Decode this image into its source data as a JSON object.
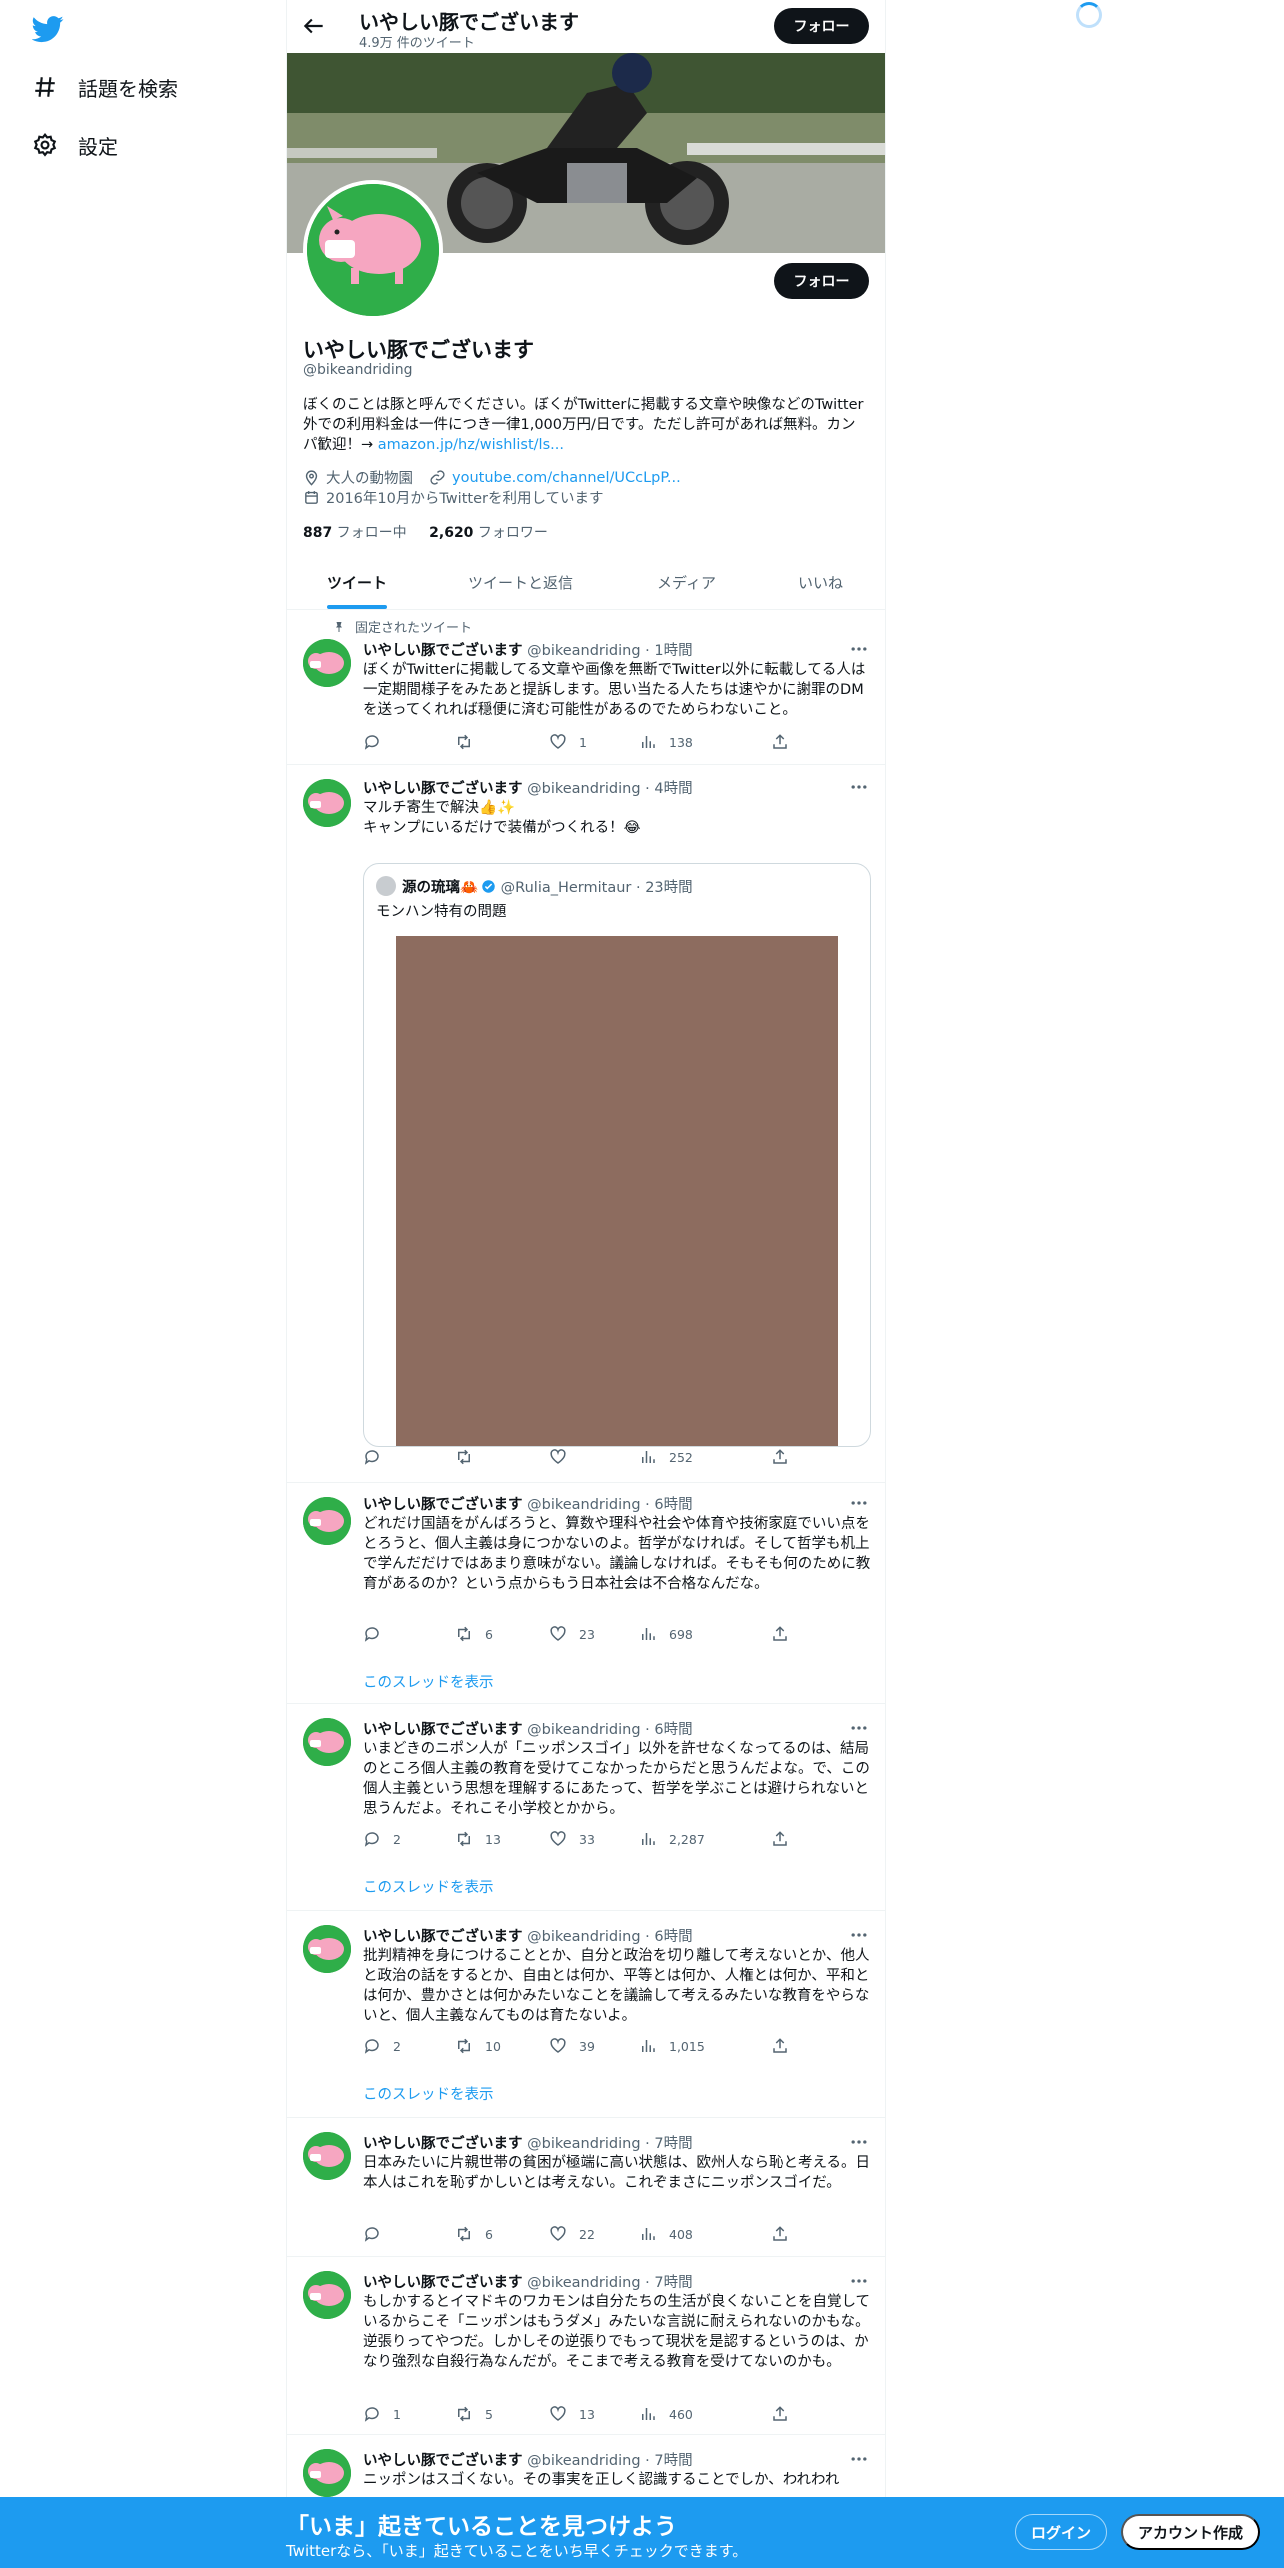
{
  "nav": {
    "logo": "twitter-bird-icon",
    "items": [
      {
        "label": "話題を検索",
        "icon": "hashtag-icon"
      },
      {
        "label": "設定",
        "icon": "gear-icon"
      }
    ]
  },
  "header": {
    "name": "いやしい豚でございます",
    "tweet_count": "4.9万 件のツイート",
    "follow_label": "フォロー"
  },
  "profile": {
    "name": "いやしい豚でございます",
    "handle": "@bikeandriding",
    "bio": "ぼくのことは豚と呼んでください。ぼくがTwitterに掲載する文章や映像などのTwitter外での利用料金は一件につき一律1,000万円/日です。ただし許可があれば無料。カンパ歓迎！→ ",
    "bio_link": "amazon.jp/hz/wishlist/ls...",
    "location": "大人の動物園",
    "url": "youtube.com/channel/UCcLpP...",
    "joined": "2016年10月からTwitterを利用しています",
    "following_count": "887",
    "following_label": " フォロー中",
    "followers_count": "2,620",
    "followers_label": " フォロワー",
    "follow_label": "フォロー"
  },
  "tabs": [
    "ツイート",
    "ツイートと返信",
    "メディア",
    "いいね"
  ],
  "tweets": [
    {
      "pinned": "固定されたツイート",
      "name": "いやしい豚でございます",
      "meta": " @bikeandriding · 1時間",
      "text": "ぼくがTwitterに掲載してる文章や画像を無断でTwitter以外に転載してる人は一定期間様子をみたあと提訴します。思い当たる人たちは速やかに謝罪のDMを送ってくれれば穏便に済む可能性があるのでためらわないこと。",
      "replies": "",
      "retweets": "",
      "likes": "1",
      "views": "138"
    },
    {
      "name": "いやしい豚でございます",
      "meta": " @bikeandriding · 4時間",
      "text": "マルチ寄生で解決👍✨\nキャンプにいるだけで装備がつくれる！😂",
      "quote": {
        "name": "源の琉璃🦀",
        "meta": " @Rulia_Hermitaur · 23時間",
        "text": "モンハン特有の問題"
      },
      "replies": "",
      "retweets": "",
      "likes": "",
      "views": "252"
    },
    {
      "name": "いやしい豚でございます",
      "meta": " @bikeandriding · 6時間",
      "text": "どれだけ国語をがんばろうと、算数や理科や社会や体育や技術家庭でいい点をとろうと、個人主義は身につかないのよ。哲学がなければ。そして哲学も机上で学んだだけではあまり意味がない。議論しなければ。そもそも何のために教育があるのか？という点からもう日本社会は不合格なんだな。",
      "replies": "",
      "retweets": "6",
      "likes": "23",
      "views": "698",
      "thread": "このスレッドを表示"
    },
    {
      "name": "いやしい豚でございます",
      "meta": " @bikeandriding · 6時間",
      "text": "いまどきのニポン人が「ニッポンスゴイ」以外を許せなくなってるのは、結局のところ個人主義の教育を受けてこなかったからだと思うんだよな。で、この個人主義という思想を理解するにあたって、哲学を学ぶことは避けられないと思うんだよ。それこそ小学校とかから。",
      "replies": "2",
      "retweets": "13",
      "likes": "33",
      "views": "2,287",
      "thread": "このスレッドを表示"
    },
    {
      "name": "いやしい豚でございます",
      "meta": " @bikeandriding · 6時間",
      "text": "批判精神を身につけることとか、自分と政治を切り離して考えないとか、他人と政治の話をするとか、自由とは何か、平等とは何か、人権とは何か、平和とは何か、豊かさとは何かみたいなことを議論して考えるみたいな教育をやらないと、個人主義なんてものは育たないよ。",
      "replies": "2",
      "retweets": "10",
      "likes": "39",
      "views": "1,015",
      "thread": "このスレッドを表示"
    },
    {
      "name": "いやしい豚でございます",
      "meta": " @bikeandriding · 7時間",
      "text": "日本みたいに片親世帯の貧困が極端に高い状態は、欧州人なら恥と考える。日本人はこれを恥ずかしいとは考えない。これぞまさにニッポンスゴイだ。",
      "replies": "",
      "retweets": "6",
      "likes": "22",
      "views": "408"
    },
    {
      "name": "いやしい豚でございます",
      "meta": " @bikeandriding · 7時間",
      "text": "もしかするとイマドキのワカモンは自分たちの生活が良くないことを自覚しているからこそ「ニッポンはもうダメ」みたいな言説に耐えられないのかもな。逆張りってやつだ。しかしその逆張りでもって現状を是認するというのは、かなり強烈な自殺行為なんだが。そこまで考える教育を受けてないのかも。",
      "replies": "1",
      "retweets": "5",
      "likes": "13",
      "views": "460"
    },
    {
      "name": "いやしい豚でございます",
      "meta": " @bikeandriding · 7時間",
      "text": "ニッポンはスゴくない。その事実を正しく認識することでしか、われわれ"
    }
  ],
  "bottom_bar": {
    "title": "「いま」起きていることを見つけよう",
    "subtitle": "Twitterなら、「いま」起きていることをいち早くチェックできます。",
    "login": "ログイン",
    "signup": "アカウント作成"
  },
  "colors": {
    "accent": "#1d9bf0",
    "avatar_bg": "#2fae49",
    "text": "#0f1419",
    "muted": "#536471"
  }
}
